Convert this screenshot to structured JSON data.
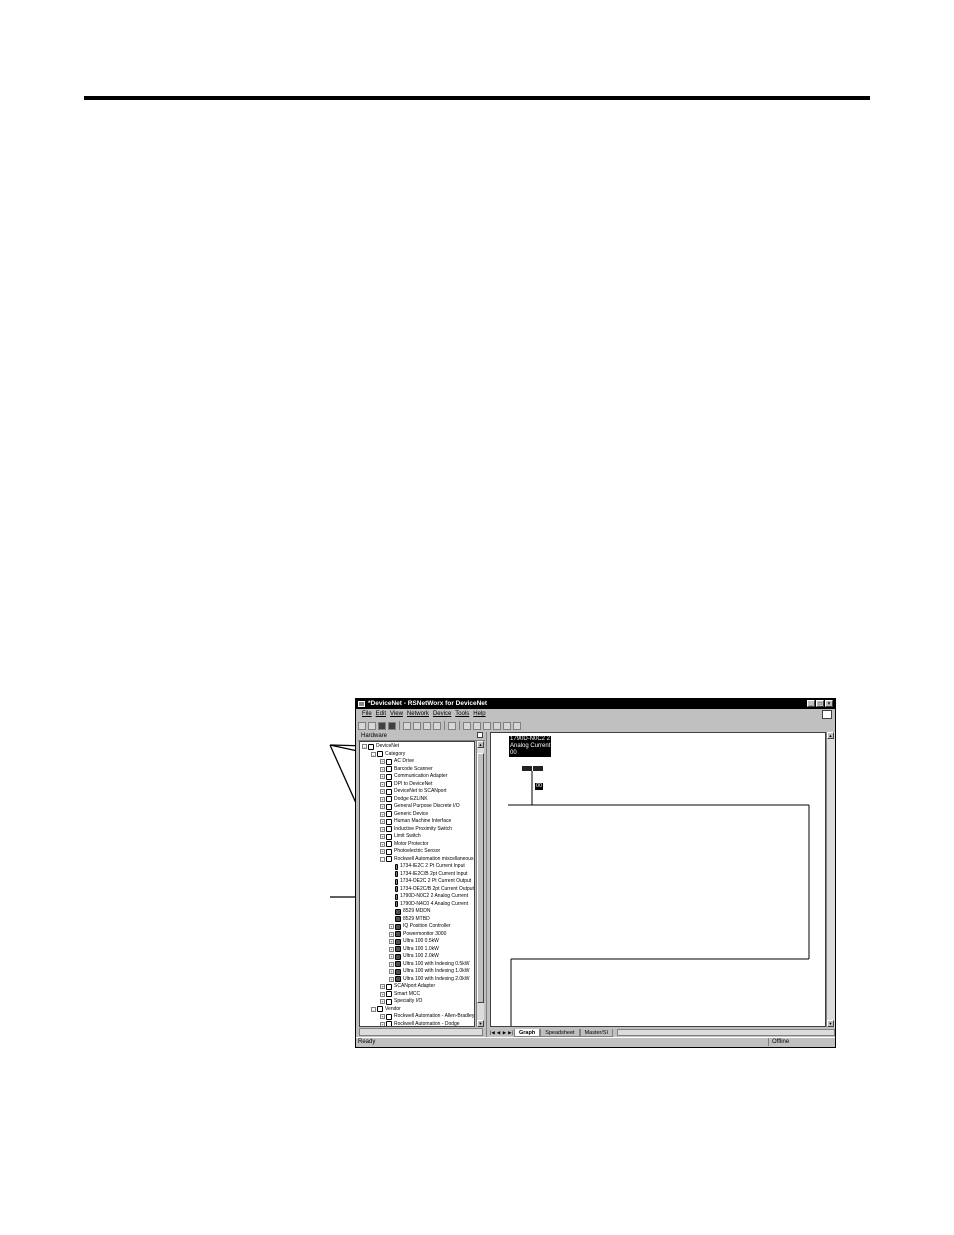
{
  "window": {
    "title": "*DeviceNet - RSNetWorx for DeviceNet",
    "controls": [
      "_",
      "□",
      "×"
    ]
  },
  "menu": [
    "File",
    "Edit",
    "View",
    "Network",
    "Device",
    "Tools",
    "Help"
  ],
  "toolbar_icons": [
    "new-icon",
    "open-icon",
    "save-icon",
    "print-icon",
    "cut-icon",
    "copy-icon",
    "paste-icon",
    "help-icon",
    "zoom-icon",
    "graph-view-icon",
    "spreadsheet-view-icon",
    "online-icon",
    "upload-icon",
    "download-icon",
    "properties-icon"
  ],
  "hardware_pane": {
    "title": "Hardware",
    "tree": [
      {
        "label": "DeviceNet",
        "level": 0,
        "expander": "-",
        "icon": "folder"
      },
      {
        "label": "Category",
        "level": 1,
        "expander": "-",
        "icon": "folder"
      },
      {
        "label": "AC Drive",
        "level": 2,
        "expander": "+",
        "icon": "folder"
      },
      {
        "label": "Barcode Scanner",
        "level": 2,
        "expander": "+",
        "icon": "folder"
      },
      {
        "label": "Communication Adapter",
        "level": 2,
        "expander": "+",
        "icon": "folder"
      },
      {
        "label": "DPI to DeviceNet",
        "level": 2,
        "expander": "+",
        "icon": "folder"
      },
      {
        "label": "DeviceNet to SCANport",
        "level": 2,
        "expander": "+",
        "icon": "folder"
      },
      {
        "label": "Dodge EZLINK",
        "level": 2,
        "expander": "+",
        "icon": "folder"
      },
      {
        "label": "General Purpose Discrete I/O",
        "level": 2,
        "expander": "+",
        "icon": "folder"
      },
      {
        "label": "Generic Device",
        "level": 2,
        "expander": "+",
        "icon": "folder"
      },
      {
        "label": "Human Machine Interface",
        "level": 2,
        "expander": "+",
        "icon": "folder"
      },
      {
        "label": "Inductive Proximity Switch",
        "level": 2,
        "expander": "+",
        "icon": "folder"
      },
      {
        "label": "Limit Switch",
        "level": 2,
        "expander": "+",
        "icon": "folder"
      },
      {
        "label": "Motor Protector",
        "level": 2,
        "expander": "+",
        "icon": "folder"
      },
      {
        "label": "Photoelectric Sensor",
        "level": 2,
        "expander": "+",
        "icon": "folder"
      },
      {
        "label": "Rockwell Automation miscellaneous",
        "level": 2,
        "expander": "-",
        "icon": "folder"
      },
      {
        "label": "1734-IE2C 2 Pt Current Input",
        "level": 3,
        "expander": "",
        "icon": "small"
      },
      {
        "label": "1734-IE2C/B 2pt Current Input",
        "level": 3,
        "expander": "",
        "icon": "small"
      },
      {
        "label": "1734-OE2C 2 Pt Current Output",
        "level": 3,
        "expander": "",
        "icon": "small"
      },
      {
        "label": "1734-OE2C/B 2pt Current Output",
        "level": 3,
        "expander": "",
        "icon": "small"
      },
      {
        "label": "1790D-N0C2 2 Analog Current",
        "level": 3,
        "expander": "",
        "icon": "small"
      },
      {
        "label": "1790D-N4C0 4 Analog Current",
        "level": 3,
        "expander": "",
        "icon": "small"
      },
      {
        "label": "8529 MDDN",
        "level": 3,
        "expander": "",
        "icon": "dev"
      },
      {
        "label": "8529 MTBD",
        "level": 3,
        "expander": "",
        "icon": "dev"
      },
      {
        "label": "IQ Position Controller",
        "level": 3,
        "expander": "+",
        "icon": "dev"
      },
      {
        "label": "Powermonitor 3000",
        "level": 3,
        "expander": "+",
        "icon": "dev"
      },
      {
        "label": "Ultra 100  0.5kW",
        "level": 3,
        "expander": "+",
        "icon": "dev"
      },
      {
        "label": "Ultra 100  1.0kW",
        "level": 3,
        "expander": "+",
        "icon": "dev"
      },
      {
        "label": "Ultra 100  2.0kW",
        "level": 3,
        "expander": "+",
        "icon": "dev"
      },
      {
        "label": "Ultra 100 with Indexing  0.5kW",
        "level": 3,
        "expander": "+",
        "icon": "dev"
      },
      {
        "label": "Ultra 100 with Indexing  1.0kW",
        "level": 3,
        "expander": "+",
        "icon": "dev"
      },
      {
        "label": "Ultra 100 with Indexing  2.0kW",
        "level": 3,
        "expander": "+",
        "icon": "dev"
      },
      {
        "label": "SCANport Adapter",
        "level": 2,
        "expander": "+",
        "icon": "folder"
      },
      {
        "label": "Smart MCC",
        "level": 2,
        "expander": "+",
        "icon": "folder"
      },
      {
        "label": "Specialty I/O",
        "level": 2,
        "expander": "+",
        "icon": "folder"
      },
      {
        "label": "Vendor",
        "level": 1,
        "expander": "-",
        "icon": "folder"
      },
      {
        "label": "Rockwell Automation - Allen-Bradley",
        "level": 2,
        "expander": "+",
        "icon": "folder"
      },
      {
        "label": "Rockwell Automation - Dodge",
        "level": 2,
        "expander": "+",
        "icon": "folder"
      }
    ]
  },
  "graph": {
    "device_label": [
      "1790D-N0C2 2",
      "Analog Current",
      "00"
    ],
    "node_address": "00"
  },
  "tabs": [
    "Graph",
    "Speadsheet",
    "Master/Sl"
  ],
  "status": {
    "left": "Ready",
    "right": "Offline"
  }
}
